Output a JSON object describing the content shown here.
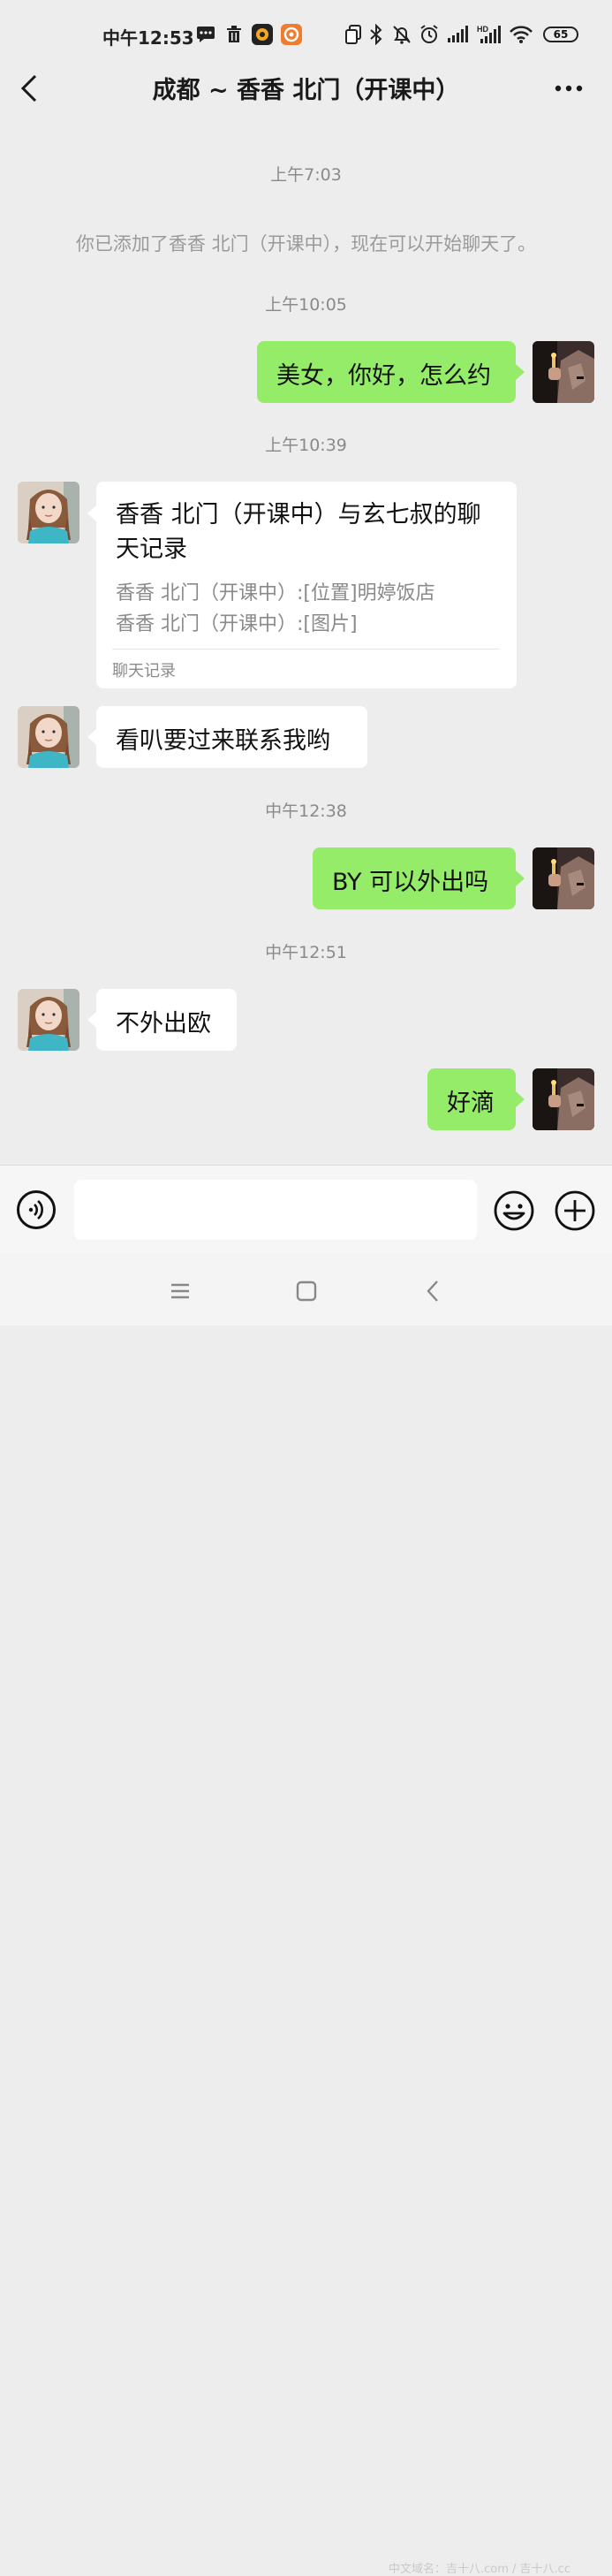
{
  "status_bar": {
    "time": "中午12:53",
    "battery": "65"
  },
  "header": {
    "title": "成都 ~ 香香  北门（开课中）"
  },
  "messages": {
    "ts1": "上午7:03",
    "system": "你已添加了香香  北门（开课中），现在可以开始聊天了。",
    "ts2": "上午10:05",
    "m1": "美女，你好，怎么约",
    "ts3": "上午10:39",
    "card": {
      "title": "香香  北门（开课中）与玄七叔的聊天记录",
      "line1": "香香  北门（开课中）:[位置]明婷饭店",
      "line2": "香香  北门（开课中）:[图片]",
      "footer": "聊天记录"
    },
    "m2": "看叭要过来联系我哟",
    "ts4": "中午12:38",
    "m3": "BY 可以外出吗",
    "ts5": "中午12:51",
    "m4": "不外出欧",
    "m5": "好滴"
  },
  "input": {
    "placeholder": ""
  },
  "watermark": "中文域名：吉十八.com / 吉十八.cc",
  "colors": {
    "bubble_self": "#95ec69",
    "bubble_other": "#ffffff",
    "background": "#ededed"
  }
}
